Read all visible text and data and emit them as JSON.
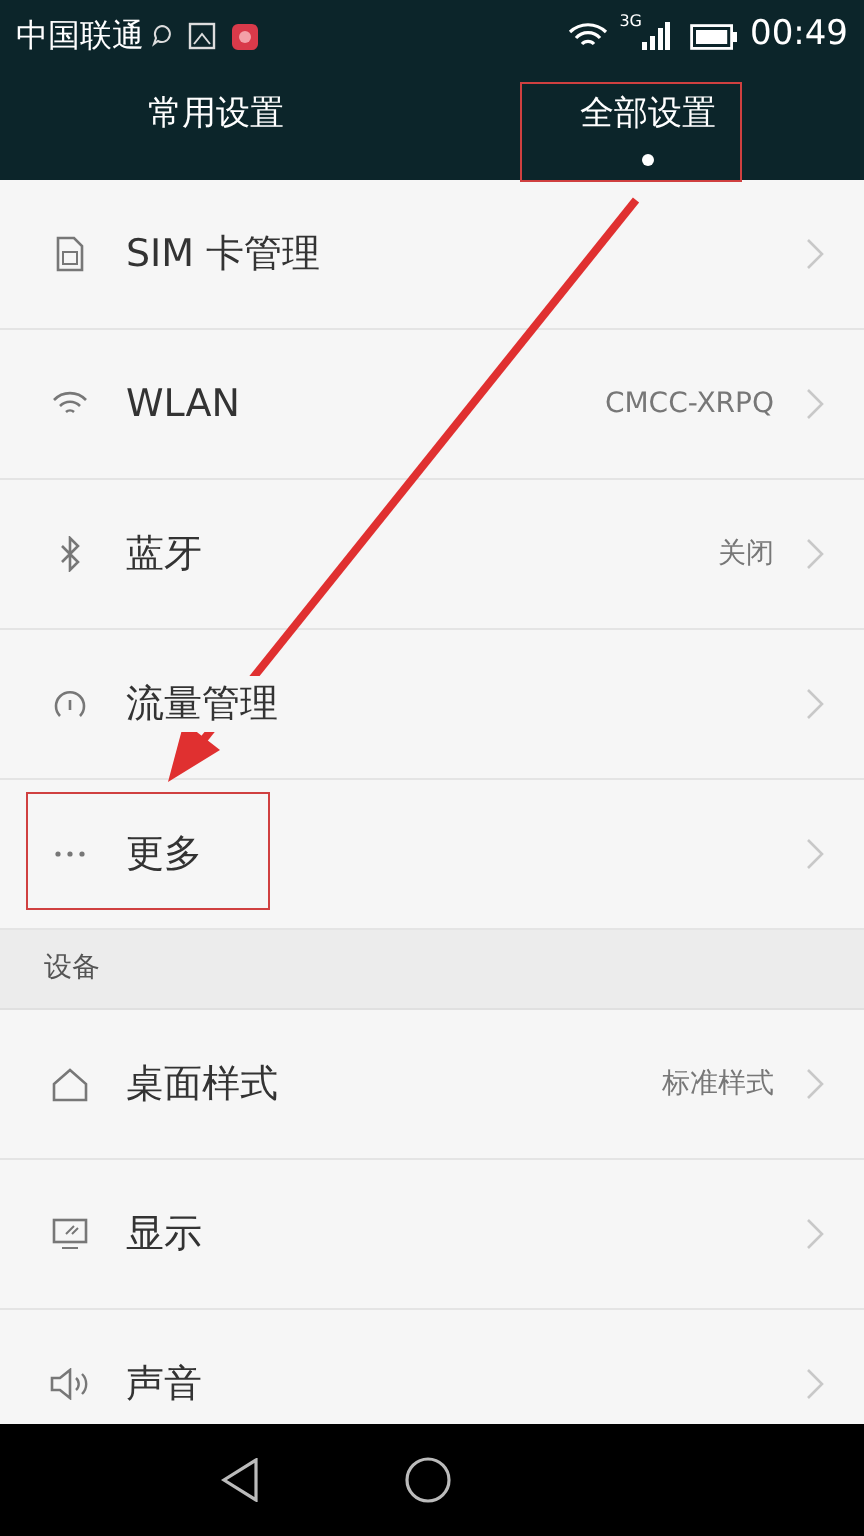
{
  "status_bar": {
    "carrier": "中国联通",
    "network": "3G",
    "time": "00:49"
  },
  "tabs": [
    {
      "label": "常用设置",
      "selected": false
    },
    {
      "label": "全部设置",
      "selected": true
    }
  ],
  "groups": [
    {
      "items": [
        {
          "label": "SIM 卡管理"
        },
        {
          "label": "WLAN",
          "value": "CMCC-XRPQ"
        },
        {
          "label": "蓝牙",
          "value": "关闭"
        },
        {
          "label": "流量管理"
        },
        {
          "label": "更多"
        }
      ]
    },
    {
      "header": "设备",
      "items": [
        {
          "label": "桌面样式",
          "value": "标准样式"
        },
        {
          "label": "显示"
        },
        {
          "label": "声音"
        }
      ]
    }
  ]
}
